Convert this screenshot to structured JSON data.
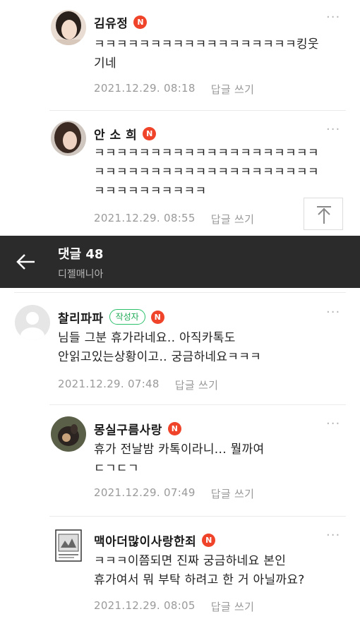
{
  "header": {
    "title": "댓글 48",
    "subtitle": "디젤매니아"
  },
  "badges": {
    "naver": "N",
    "author": "작성자"
  },
  "comments_top": [
    {
      "name": "김유정",
      "text": "ㅋㅋㅋㅋㅋㅋㅋㅋㅋㅋㅋㅋㅋㅋㅋㅋㅋㅋ킹웃\n기네",
      "date": "2021.12.29. 08:18",
      "reply": "답글 쓰기"
    },
    {
      "name": "안 소 희",
      "text": "ㅋㅋㅋㅋㅋㅋㅋㅋㅋㅋㅋㅋㅋㅋㅋㅋㅋㅋㅋㅋ\nㅋㅋㅋㅋㅋㅋㅋㅋㅋㅋㅋㅋㅋㅋㅋㅋㅋㅋㅋㅋ\nㅋㅋㅋㅋㅋㅋㅋㅋㅋㅋ",
      "date": "2021.12.29. 08:55",
      "reply": "답글 쓰기"
    }
  ],
  "comments": [
    {
      "name": "찰리파파",
      "text": "님들 그분 휴가라네요.. 아직카톡도\n안읽고있는상황이고.. 궁금하네요ㅋㅋㅋ",
      "date": "2021.12.29. 07:48",
      "reply": "답글 쓰기"
    },
    {
      "name": "몽실구름사랑",
      "text": "휴가 전날밤 카톡이라니... 뭘까여\nㄷㄱㄷㄱ",
      "date": "2021.12.29. 07:49",
      "reply": "답글 쓰기"
    },
    {
      "name": "맥아더많이사랑한죄",
      "text": "ㅋㅋㅋ이쯤되면 진짜 궁금하네요 본인\n휴가여서 뭐 부탁 하려고 한 거 아닐까요?",
      "date": "2021.12.29. 08:05",
      "reply": "답글 쓰기"
    }
  ],
  "icons": {
    "more": "more-icon",
    "back": "back-arrow-icon",
    "scroll_top": "scroll-top-icon"
  },
  "colors": {
    "badge_red": "#f0442a",
    "author_green": "#2cc06b",
    "header_bg": "#2b2b2b"
  }
}
